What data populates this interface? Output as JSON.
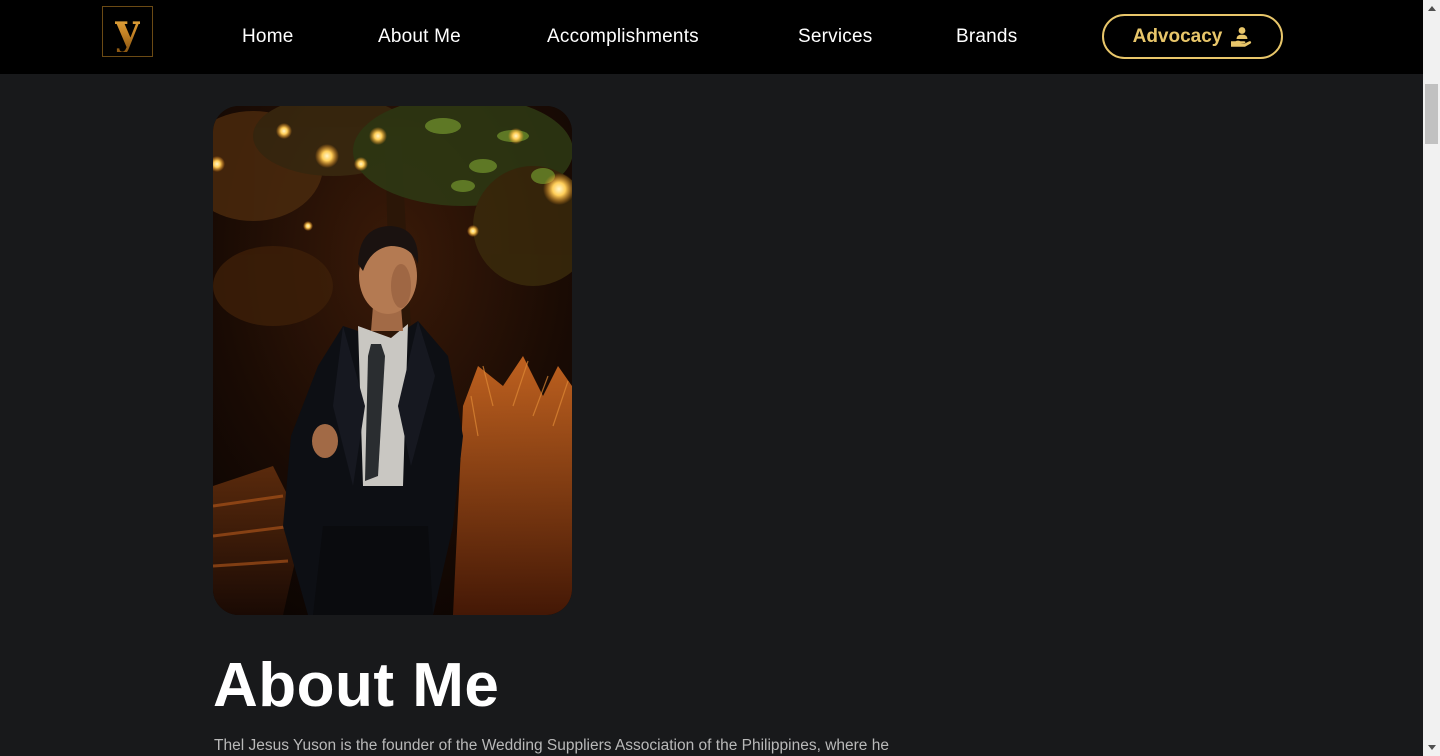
{
  "navbar": {
    "logo_letter": "y",
    "links": [
      {
        "label": "Home"
      },
      {
        "label": "About Me"
      },
      {
        "label": "Accomplishments"
      },
      {
        "label": "Services"
      },
      {
        "label": "Brands"
      }
    ],
    "cta_label": "Advocacy",
    "cta_icon": "hand-holding-person-icon"
  },
  "hero_photo": {
    "icon": "portrait-photo"
  },
  "about": {
    "heading": "About Me",
    "paragraph": "Thel Jesus Yuson is the founder of the Wedding Suppliers Association of the Philippines, where he"
  },
  "colors": {
    "navbar_bg": "#000000",
    "page_bg": "#18191b",
    "accent_gold": "#e8c66a",
    "logo_gold": "#c7902d",
    "text_primary": "#ffffff",
    "text_muted": "#b9b9b9"
  }
}
